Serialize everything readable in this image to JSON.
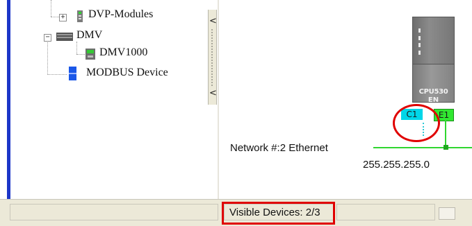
{
  "tree": {
    "items": [
      {
        "label": "DVP-Modules",
        "expander": "+"
      },
      {
        "label": "DMV",
        "expander": "−"
      },
      {
        "label": "DMV1000",
        "expander": ""
      },
      {
        "label": "MODBUS Device",
        "expander": ""
      }
    ]
  },
  "splitter": {
    "arrow_up": "<",
    "arrow_down": "<"
  },
  "diagram": {
    "plc_model": "CPU530",
    "plc_sub": "EN",
    "port_c1": "C1",
    "port_e1": "E1",
    "network_label": "Network #:2  Ethernet",
    "ip_address": "255.255.255.0",
    "colors": {
      "port_c1": "#00d6e8",
      "port_e1": "#31e831",
      "highlight": "#e00000"
    }
  },
  "status_bar": {
    "visible_devices": "Visible Devices: 2/3"
  }
}
